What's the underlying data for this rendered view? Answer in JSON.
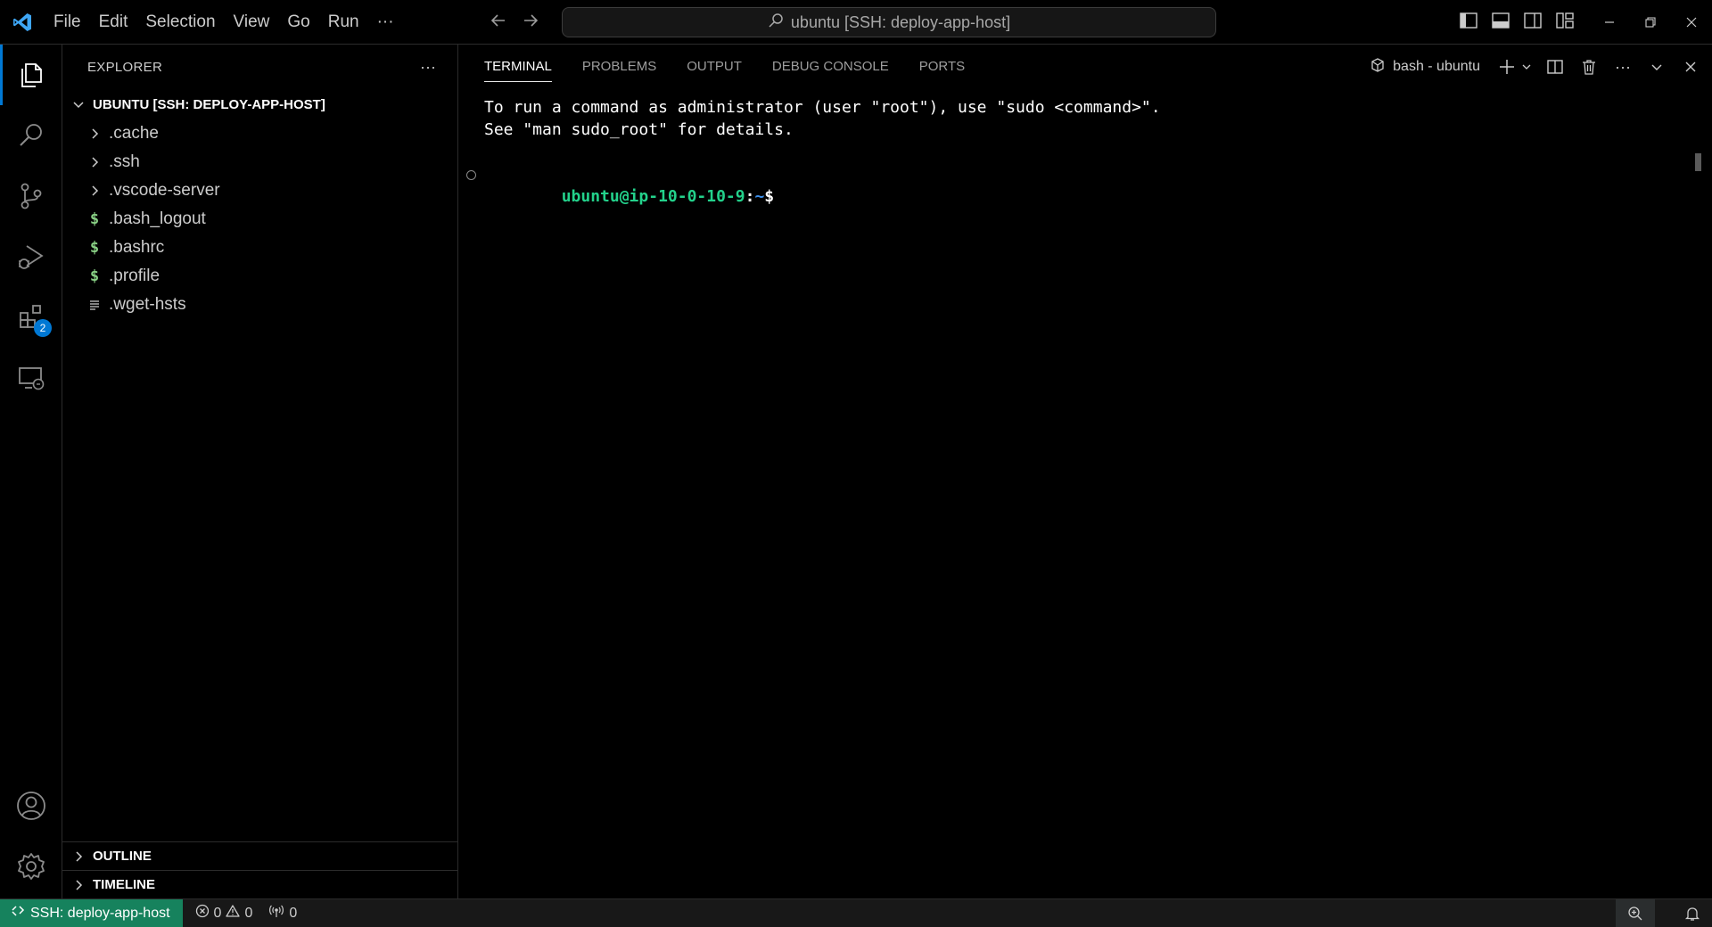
{
  "menu": [
    "File",
    "Edit",
    "Selection",
    "View",
    "Go",
    "Run"
  ],
  "menu_more": "···",
  "command_center": {
    "text": "ubuntu [SSH: deploy-app-host]"
  },
  "explorer": {
    "title": "EXPLORER",
    "more": "···",
    "folder": "UBUNTU [SSH: DEPLOY-APP-HOST]",
    "items": [
      {
        "name": ".cache",
        "type": "folder"
      },
      {
        "name": ".ssh",
        "type": "folder"
      },
      {
        "name": ".vscode-server",
        "type": "folder"
      },
      {
        "name": ".bash_logout",
        "type": "shell"
      },
      {
        "name": ".bashrc",
        "type": "shell"
      },
      {
        "name": ".profile",
        "type": "shell"
      },
      {
        "name": ".wget-hsts",
        "type": "text"
      }
    ],
    "outline": "OUTLINE",
    "timeline": "TIMELINE"
  },
  "activity": {
    "extensions_badge": "2"
  },
  "panel": {
    "tabs": [
      "TERMINAL",
      "PROBLEMS",
      "OUTPUT",
      "DEBUG CONSOLE",
      "PORTS"
    ],
    "active_tab": "TERMINAL",
    "terminal_name": "bash - ubuntu"
  },
  "terminal": {
    "lines": [
      "To run a command as administrator (user \"root\"), use \"sudo <command>\".",
      "See \"man sudo_root\" for details."
    ],
    "prompt_user": "ubuntu@ip-10-0-10-9",
    "prompt_sep": ":",
    "prompt_path": "~",
    "prompt_symbol": "$"
  },
  "status": {
    "remote": "SSH: deploy-app-host",
    "errors": "0",
    "warnings": "0",
    "ports": "0"
  },
  "colors": {
    "accent": "#0078d4",
    "remote_bg": "#16825d",
    "prompt_green": "#23d18b",
    "shell_icon": "#89d185"
  }
}
